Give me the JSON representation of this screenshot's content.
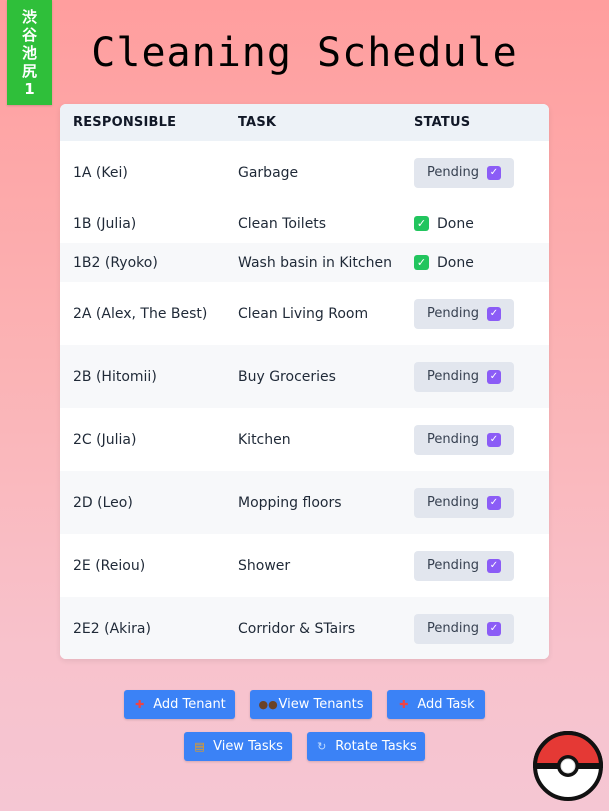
{
  "badge": {
    "chars": [
      "渋",
      "谷",
      "池",
      "尻",
      "1"
    ]
  },
  "title": "Cleaning Schedule",
  "table": {
    "headers": [
      "RESPONSIBLE",
      "TASK",
      "STATUS"
    ],
    "rows": [
      {
        "responsible": "1A (Kei)",
        "task": "Garbage",
        "status": "Pending"
      },
      {
        "responsible": "1B (Julia)",
        "task": "Clean Toilets",
        "status": "Done"
      },
      {
        "responsible": "1B2 (Ryoko)",
        "task": "Wash basin in Kitchen",
        "status": "Done"
      },
      {
        "responsible": "2A (Alex, The Best)",
        "task": "Clean Living Room",
        "status": "Pending"
      },
      {
        "responsible": "2B (Hitomii)",
        "task": "Buy Groceries",
        "status": "Pending"
      },
      {
        "responsible": "2C (Julia)",
        "task": "Kitchen",
        "status": "Pending"
      },
      {
        "responsible": "2D (Leo)",
        "task": "Mopping floors",
        "status": "Pending"
      },
      {
        "responsible": "2E (Reiou)",
        "task": "Shower",
        "status": "Pending"
      },
      {
        "responsible": "2E2 (Akira)",
        "task": "Corridor & STairs",
        "status": "Pending"
      }
    ]
  },
  "buttons": {
    "add_tenant": {
      "label": "Add Tenant",
      "icon": "plus-icon"
    },
    "view_tenants": {
      "label": "View Tenants",
      "icon": "people-icon"
    },
    "add_task": {
      "label": "Add Task",
      "icon": "plus-icon"
    },
    "view_tasks": {
      "label": "View Tasks",
      "icon": "clipboard-icon"
    },
    "rotate_tasks": {
      "label": "Rotate Tasks",
      "icon": "rotate-icon"
    }
  },
  "colors": {
    "badge": "#2fbf3a",
    "button": "#3b82f6",
    "pending_bg": "#e2e6ee",
    "pending_check": "#8b5cf6",
    "done_check": "#22c55e"
  }
}
